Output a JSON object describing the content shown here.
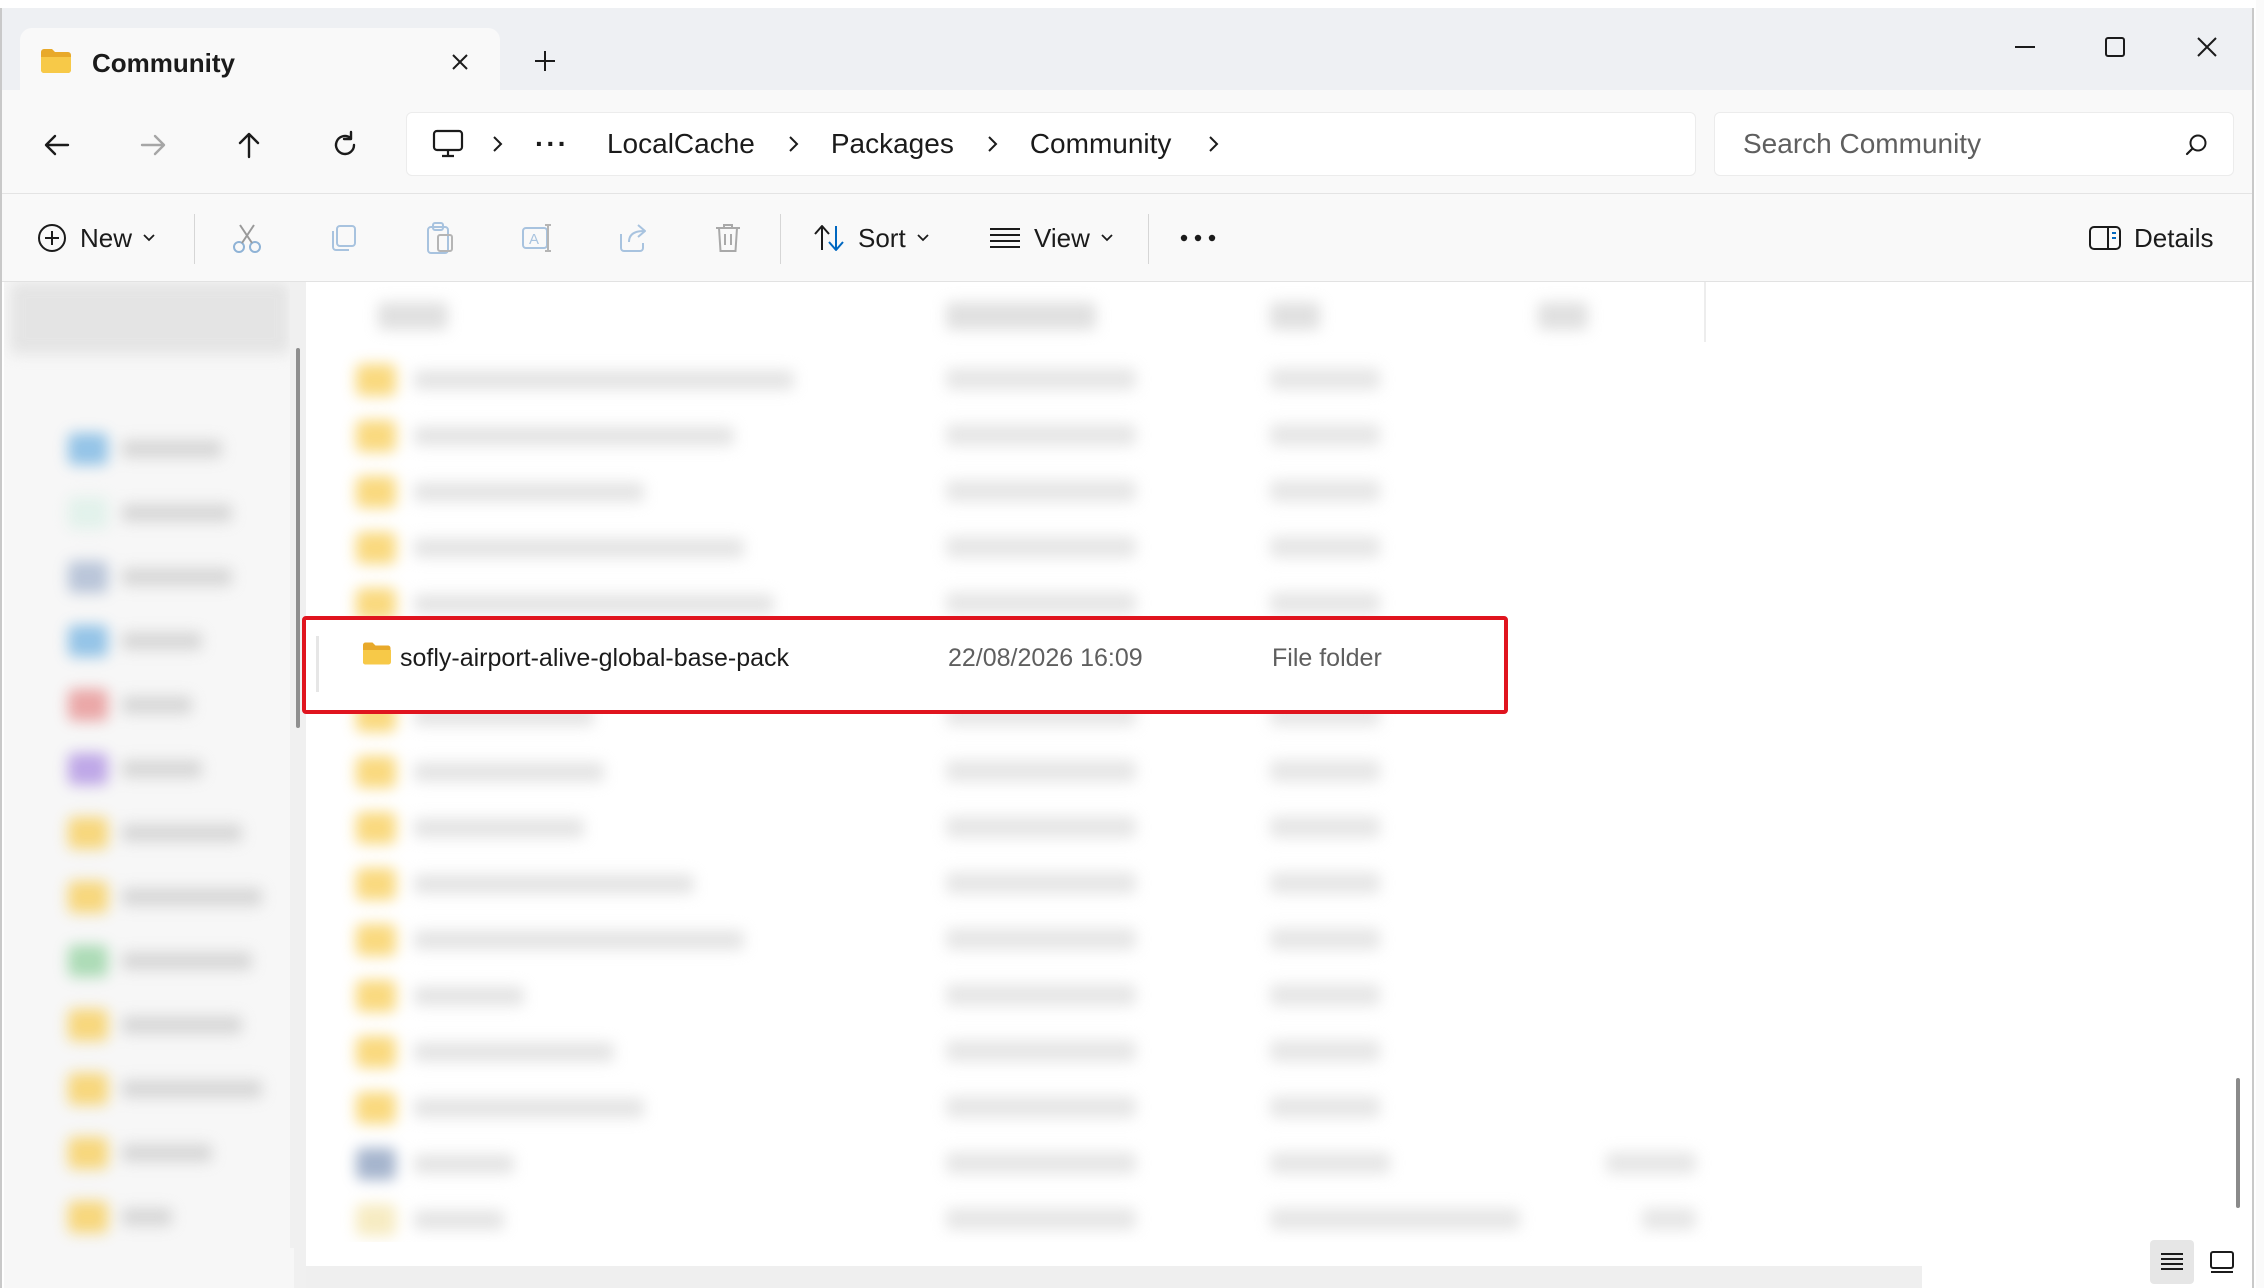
{
  "window": {
    "tab_title": "Community"
  },
  "breadcrumb": {
    "overflow": "···",
    "items": [
      "LocalCache",
      "Packages",
      "Community"
    ]
  },
  "search": {
    "placeholder": "Search Community"
  },
  "toolbar": {
    "new_label": "New",
    "sort_label": "Sort",
    "view_label": "View",
    "details_label": "Details"
  },
  "highlighted_item": {
    "name": "sofly-airport-alive-global-base-pack",
    "date_modified": "22/08/2026 16:09",
    "type": "File folder"
  },
  "colors": {
    "highlight_border": "#e0141e",
    "folder": "#f7c948",
    "accent": "#0067c0"
  }
}
